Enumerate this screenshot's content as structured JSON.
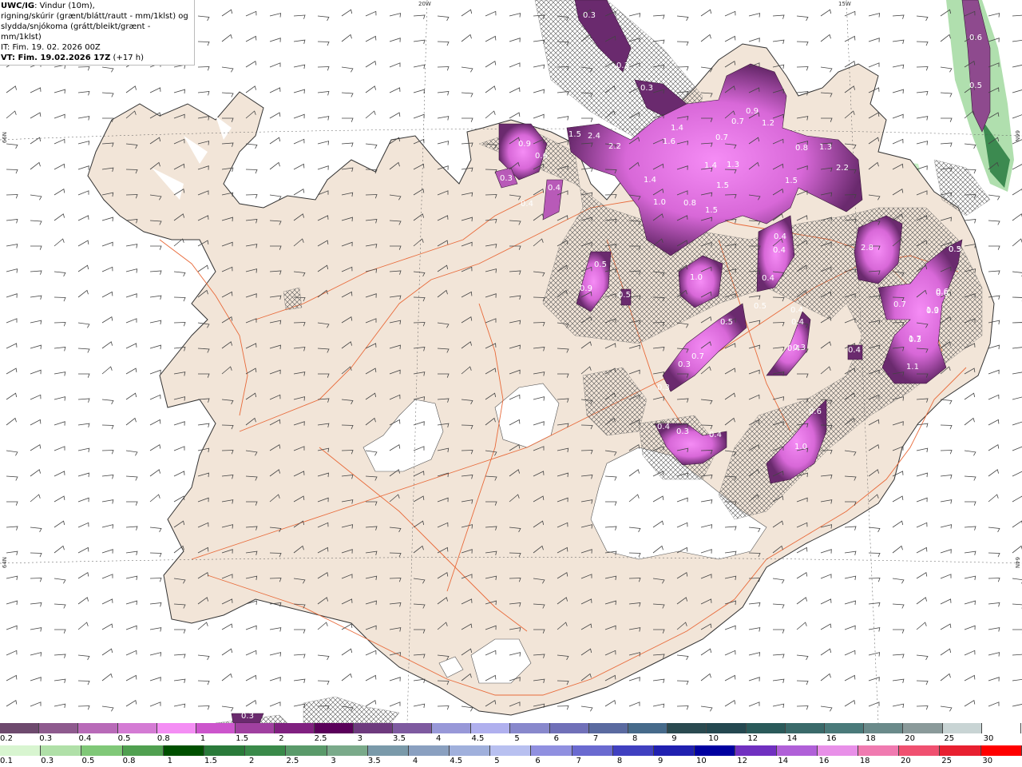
{
  "title_block": {
    "model": "UWC/IG",
    "desc1": ": Vindur (10m),",
    "desc2": "rigning/skúrir (grænt/blátt/rautt - mm/1klst) og",
    "desc3": "slydda/snjókoma (grátt/bleikt/grænt - mm/1klst)",
    "it_line": "IT: Fim. 19. 02. 2026 00Z",
    "vt_bold": "VT: Fim. 19.02.2026 17Z",
    "vt_rest": " (+17 h)"
  },
  "graticule": {
    "top": [
      "20W",
      "15W"
    ],
    "left": [
      "66N",
      "64N"
    ],
    "right": [
      "66N",
      "64N"
    ]
  },
  "colors": {
    "land": "#f2e5d8",
    "coast": "#333333",
    "roads": "#e86a3a",
    "glacier": "#ffffff",
    "snow_light": "#cc66cc",
    "snow_mid": "#ee66ee",
    "snow_dark": "#6a2a6e",
    "rain_light": "#a7dba5"
  },
  "precip_labels": [
    "0.3",
    "0.3",
    "0.3",
    "0.9",
    "0.6",
    "0.3",
    "0.4",
    "0.4",
    "1.5",
    "2.4",
    "2.2",
    "1.4",
    "1.6",
    "0.7",
    "1.2",
    "0.9",
    "0.7",
    "1.4",
    "1.3",
    "1.5",
    "0.8",
    "1.3",
    "2.2",
    "1.4",
    "1.0",
    "0.8",
    "1.5",
    "1.5",
    "0.4",
    "0.4",
    "0.4",
    "0.4",
    "2.8",
    "0.5",
    "0.5",
    "0.9",
    "0.5",
    "1.0",
    "0.5",
    "0.7",
    "0.6",
    "0.3",
    "0.4",
    "0.3",
    "0.4",
    "0.3",
    "0.4",
    "0.3",
    "1.7",
    "1.0",
    "0.6",
    "0.7",
    "1.1",
    "0.3",
    "0.4",
    "0.3",
    "0.4",
    "1.0",
    "0.6",
    "0.5",
    "0.5",
    "0.6",
    "0.3",
    "0.3"
  ],
  "legend_snow": {
    "labels": [
      "0.2",
      "0.3",
      "0.4",
      "0.5",
      "0.8",
      "1",
      "1.5",
      "2",
      "2.5",
      "3",
      "3.5",
      "4",
      "4.5",
      "5",
      "6",
      "7",
      "8",
      "9",
      "10",
      "12",
      "14",
      "16",
      "18",
      "20",
      "25",
      "30"
    ],
    "colors": [
      "#6e4a6e",
      "#8e5a8e",
      "#b86ab8",
      "#d47bd4",
      "#f48ef4",
      "#cc55cc",
      "#a040a0",
      "#802080",
      "#5a005a",
      "#6e3a7e",
      "#7e5aa0",
      "#9898d8",
      "#b0b0ee",
      "#8888cc",
      "#7070b8",
      "#5a6aa0",
      "#466a8a",
      "#2a4a50",
      "#244850",
      "#2a5a5a",
      "#3a6a6a",
      "#4a7a7a",
      "#6a8a8a",
      "#8a9a9a",
      "#c8d4d4",
      "#ffffff"
    ]
  },
  "legend_rain": {
    "labels": [
      "0.1",
      "0.3",
      "0.5",
      "0.8",
      "1",
      "1.5",
      "2",
      "2.5",
      "3",
      "3.5",
      "4",
      "4.5",
      "5",
      "6",
      "7",
      "8",
      "9",
      "10",
      "12",
      "14",
      "16",
      "18",
      "20",
      "25",
      "30"
    ],
    "colors": [
      "#d8f5d0",
      "#b0e0a8",
      "#80c878",
      "#50a050",
      "#005000",
      "#2a7a3a",
      "#3a8a4a",
      "#5a9a6a",
      "#7aaa8a",
      "#7a9aaa",
      "#8aa0c0",
      "#a0b0dc",
      "#b8c0f0",
      "#9090e0",
      "#6a6ad0",
      "#4040c0",
      "#2020b0",
      "#0000a0",
      "#7030c0",
      "#b060d8",
      "#e890e8",
      "#f07ab0",
      "#f05070",
      "#e82030",
      "#ff0000"
    ]
  }
}
